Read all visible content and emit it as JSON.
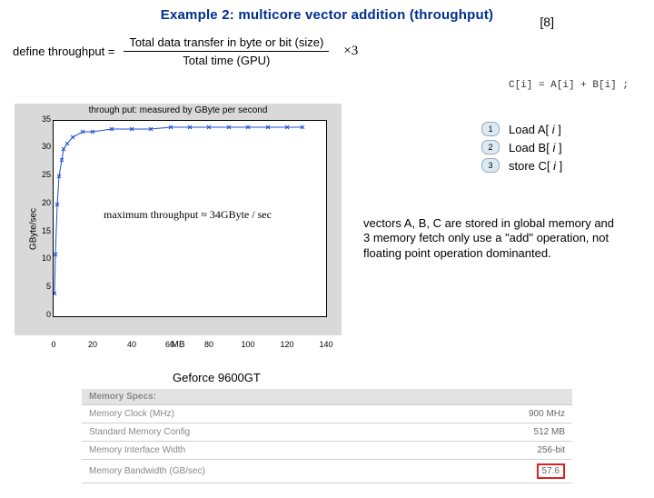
{
  "title": "Example 2: multicore vector addition (throughput)",
  "page_mark": "[8]",
  "formula": {
    "lhs": "define throughput =",
    "num": "Total data transfer in byte or bit  (size)",
    "den": "Total time (GPU)",
    "mult": "×3"
  },
  "code": "C[i] = A[i] + B[i] ;",
  "steps": {
    "n1": "1",
    "n2": "2",
    "n3": "3",
    "t1a": "Load A[",
    "t1b": " i ",
    "t1c": "]",
    "t2a": "Load B[",
    "t2b": " i ",
    "t2c": "]",
    "t3a": "store C[",
    "t3b": " i ",
    "t3c": "]"
  },
  "notes": "vectors A, B, C are stored in global memory and 3 memory fetch only use a \"add\" operation, not floating point operation dominanted.",
  "gpu_label": "Geforce 9600GT",
  "spec": {
    "hdr": "Memory Specs:",
    "r1a": "Memory Clock (MHz)",
    "r1b": "900 MHz",
    "r2a": "Standard Memory Config",
    "r2b": "512 MB",
    "r3a": "Memory Interface Width",
    "r3b": "256-bit",
    "r4a": "Memory Bandwidth (GB/sec)",
    "r4b": "57.6"
  },
  "chart_data": {
    "type": "line",
    "title": "through put: measured by GByte per second",
    "xlabel": "MB",
    "ylabel": "GByte/sec",
    "xlim": [
      0,
      140
    ],
    "ylim": [
      0,
      35
    ],
    "xticks": [
      0,
      20,
      40,
      60,
      80,
      100,
      120,
      140
    ],
    "yticks": [
      0,
      5,
      10,
      15,
      20,
      25,
      30,
      35
    ],
    "annotation": "maximum throughput ≈ 34GByte / sec",
    "x": [
      0.5,
      1,
      2,
      3,
      4,
      5,
      7,
      10,
      15,
      20,
      30,
      40,
      50,
      60,
      70,
      80,
      90,
      100,
      110,
      120,
      128
    ],
    "y": [
      4,
      11,
      20,
      25,
      28,
      30,
      31,
      32,
      33,
      33,
      33.5,
      33.5,
      33.5,
      33.8,
      33.8,
      33.8,
      33.8,
      33.8,
      33.8,
      33.8,
      33.8
    ]
  }
}
